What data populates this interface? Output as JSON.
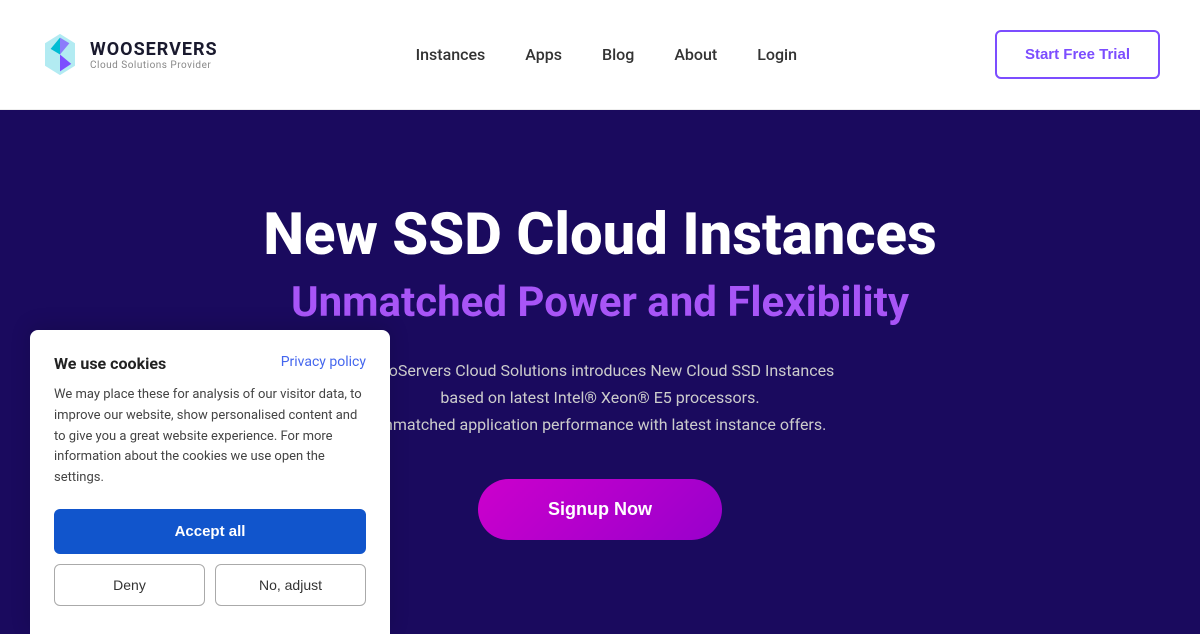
{
  "header": {
    "logo_name": "WOOSERVERS",
    "logo_tagline": "Cloud Solutions Provider",
    "nav": {
      "items": [
        {
          "label": "Instances",
          "href": "#"
        },
        {
          "label": "Apps",
          "href": "#"
        },
        {
          "label": "Blog",
          "href": "#"
        },
        {
          "label": "About",
          "href": "#"
        },
        {
          "label": "Login",
          "href": "#"
        }
      ]
    },
    "cta_label": "Start Free Trial"
  },
  "hero": {
    "title": "New SSD Cloud Instances",
    "subtitle": "Unmatched Power and Flexibility",
    "description_line1": "WooServers Cloud Solutions introduces New Cloud SSD Instances",
    "description_line2": "based on latest Intel® Xeon® E5 processors.",
    "description_line3": "Unmatched application performance with latest instance offers.",
    "signup_label": "Signup Now"
  },
  "cookie": {
    "title": "We use cookies",
    "privacy_label": "Privacy policy",
    "body": "We may place these for analysis of our visitor data, to improve our website, show personalised content and to give you a great website experience. For more information about the cookies we use open the settings.",
    "accept_label": "Accept all",
    "deny_label": "Deny",
    "adjust_label": "No, adjust"
  }
}
